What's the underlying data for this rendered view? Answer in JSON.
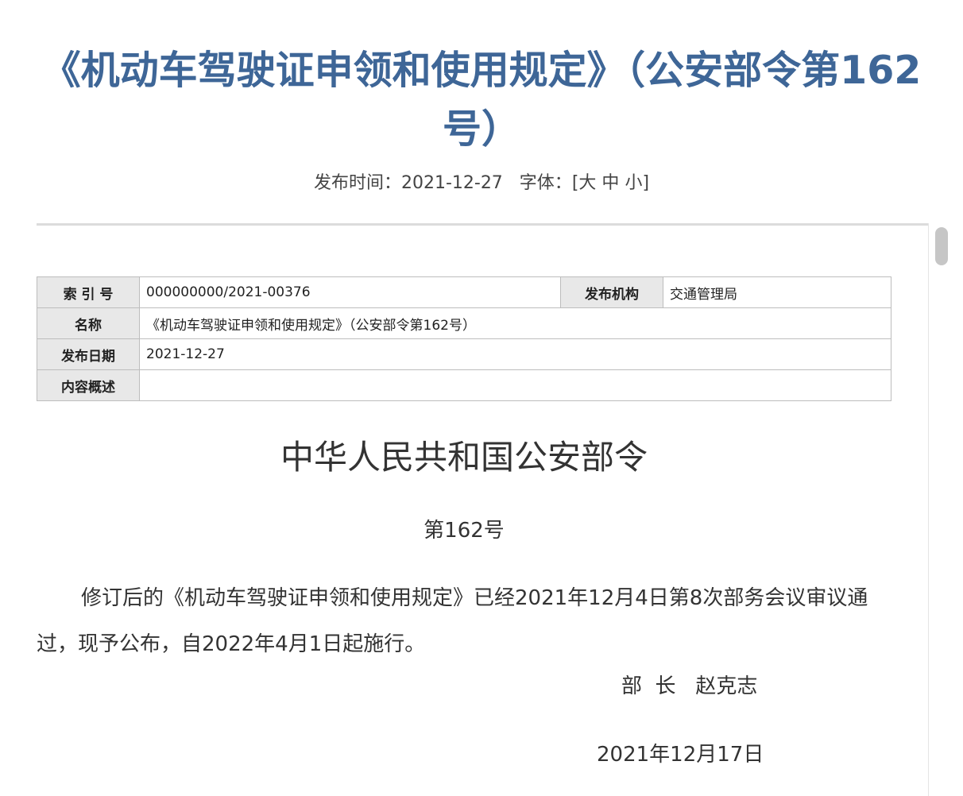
{
  "header": {
    "title": "《机动车驾驶证申领和使用规定》（公安部令第162号）",
    "publish_time_label": "发布时间：",
    "publish_time_value": "2021-12-27",
    "font_label": "字体：",
    "font_open": "[",
    "font_large": "大",
    "font_medium": "中",
    "font_small": "小",
    "font_close": "]"
  },
  "info_table": {
    "index_label": "索 引 号",
    "index_value": "000000000/2021-00376",
    "agency_label": "发布机构",
    "agency_value": "交通管理局",
    "name_label": "名称",
    "name_value": "《机动车驾驶证申领和使用规定》（公安部令第162号）",
    "date_label": "发布日期",
    "date_value": "2021-12-27",
    "summary_label": "内容概述",
    "summary_value": ""
  },
  "document": {
    "heading": "中华人民共和国公安部令",
    "number": "第162号",
    "body": "修订后的《机动车驾驶证申领和使用规定》已经2021年12月4日第8次部务会议审议通过，现予公布，自2022年4月1日起施行。",
    "signature_title": "部  长",
    "signature_name": "赵克志",
    "date": "2021年12月17日"
  },
  "colors": {
    "title": "#3e6697",
    "label_bg": "#e8e8e8",
    "border": "#bdbdbd"
  }
}
